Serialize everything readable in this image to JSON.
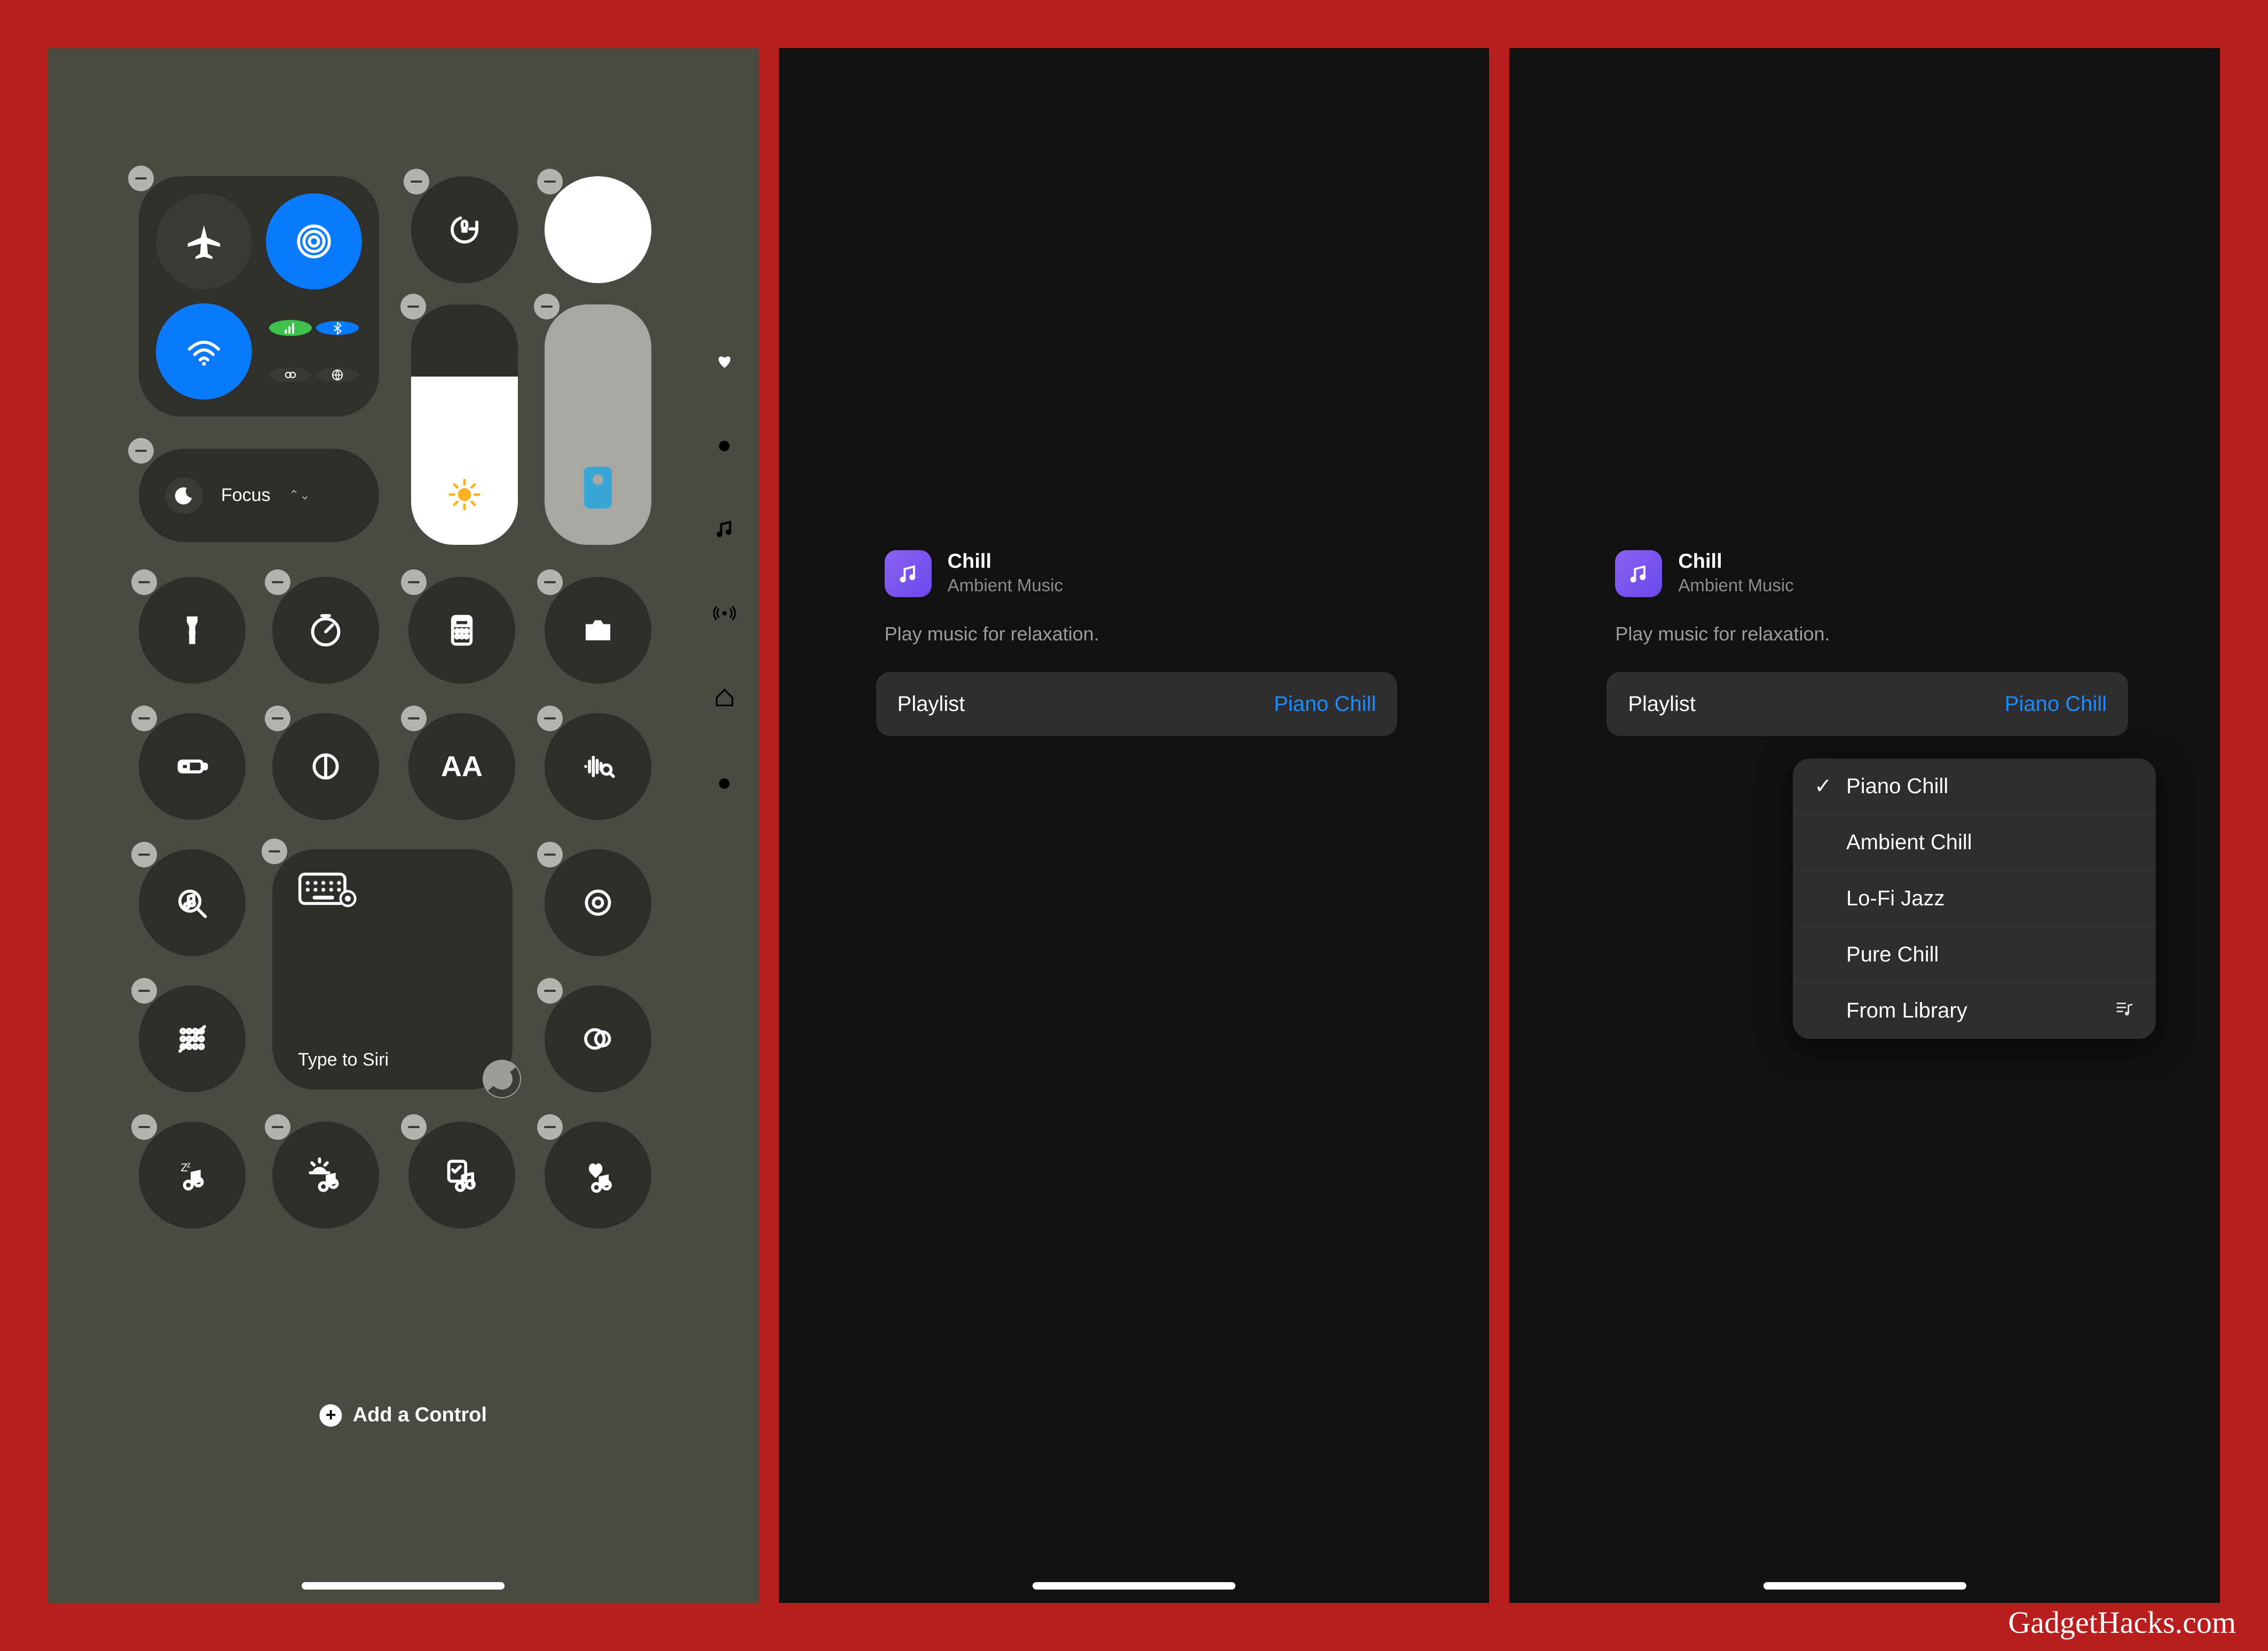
{
  "watermark": "GadgetHacks.com",
  "phone1": {
    "focus_label": "Focus",
    "type_to_siri": "Type to Siri",
    "add_control": "Add a Control",
    "icons": {
      "airplane": "airplane",
      "airdrop": "airdrop",
      "wifi": "wifi",
      "cellular": "cellular",
      "bluetooth": "bluetooth",
      "hotspot": "hotspot",
      "vpn": "vpn",
      "rotation_lock": "rotation-lock",
      "silent": "silent",
      "brightness": "brightness",
      "volume": "volume",
      "torch": "torch",
      "timer": "timer",
      "calculator": "calculator",
      "camera": "camera",
      "low_power": "low-power",
      "dark_mode": "dark-mode",
      "text_size": "text-size",
      "sound_recognition": "sound-recognition",
      "music_recognition": "music-recognition",
      "keyboard": "keyboard",
      "accessibility": "accessibility",
      "record": "record",
      "ring": "ring",
      "sleep_music": "sleep-music",
      "sunrise_music": "sunrise-music",
      "checklist_music": "checklist-music",
      "heart_music": "heart-music"
    },
    "sidebar": [
      "heart",
      "dot",
      "music",
      "broadcast",
      "home",
      "dot"
    ]
  },
  "phone2": {
    "title": "Chill",
    "subtitle": "Ambient Music",
    "description": "Play music for relaxation.",
    "playlist_label": "Playlist",
    "playlist_value": "Piano Chill"
  },
  "phone3": {
    "title": "Chill",
    "subtitle": "Ambient Music",
    "description": "Play music for relaxation.",
    "playlist_label": "Playlist",
    "playlist_value": "Piano Chill",
    "options": [
      "Piano Chill",
      "Ambient Chill",
      "Lo-Fi Jazz",
      "Pure Chill",
      "From Library"
    ],
    "selected": "Piano Chill",
    "library_label": "From Library"
  }
}
